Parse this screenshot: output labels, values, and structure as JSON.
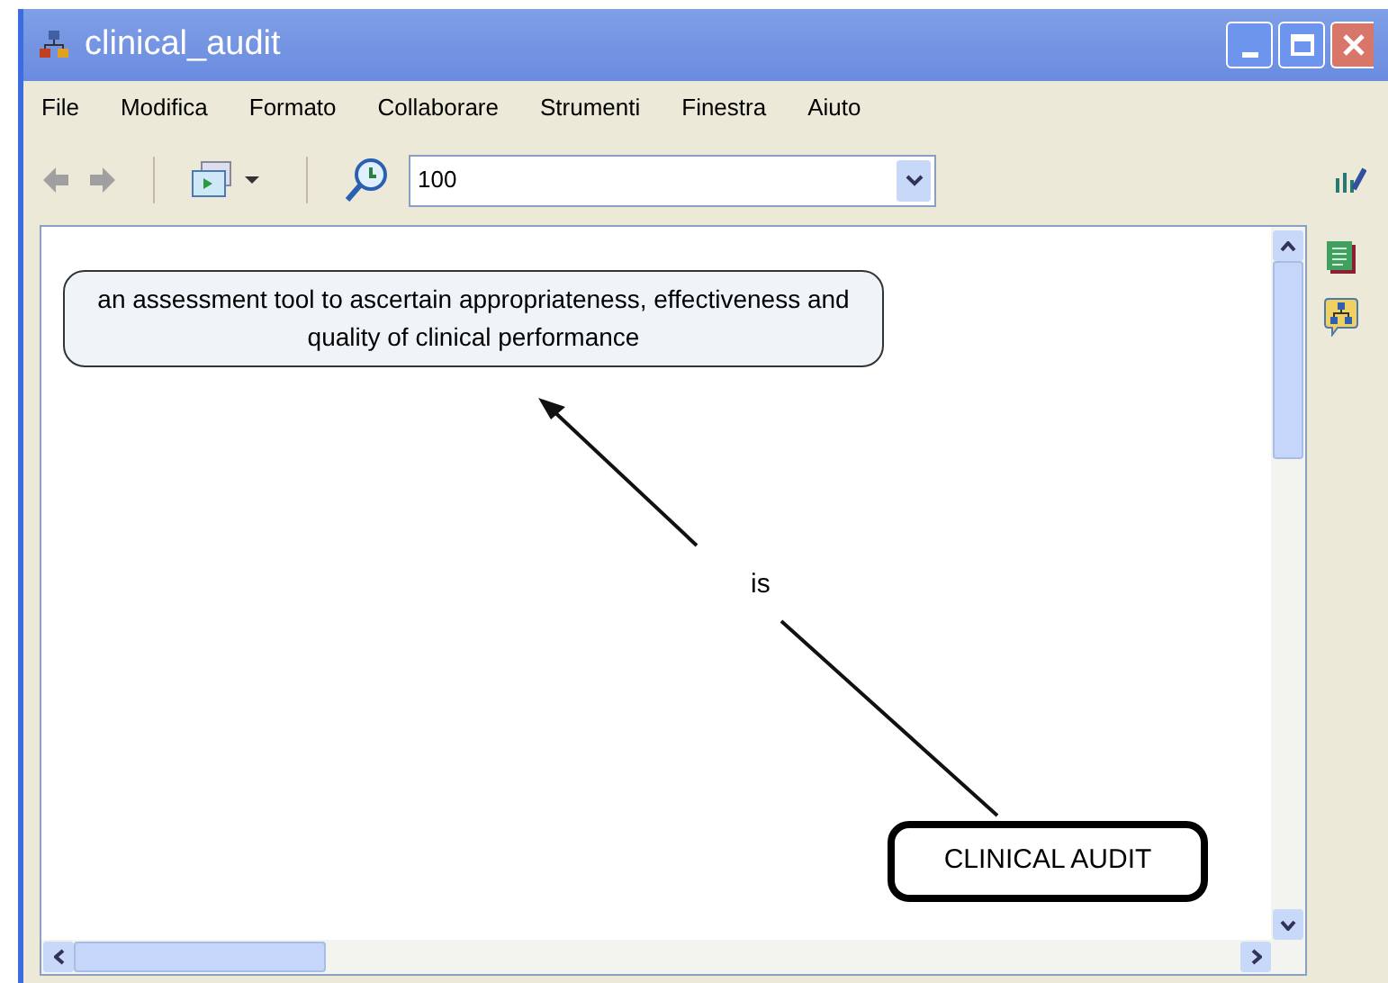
{
  "window": {
    "title": "clinical_audit"
  },
  "menu": [
    "File",
    "Modifica",
    "Formato",
    "Collaborare",
    "Strumenti",
    "Finestra",
    "Aiuto"
  ],
  "toolbar": {
    "zoom": "100"
  },
  "map": {
    "concepts": [
      {
        "text": "an assessment tool to ascertain appropriateness, effectiveness and quality of clinical performance",
        "selected": false
      },
      {
        "text": "CLINICAL AUDIT",
        "selected": true
      }
    ],
    "link": {
      "label": "is"
    }
  }
}
